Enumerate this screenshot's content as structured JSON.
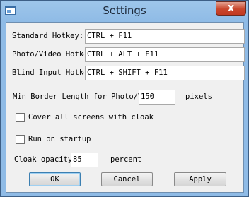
{
  "window": {
    "title": "Settings",
    "app_icon": "window-app-icon",
    "close_glyph": "X"
  },
  "hotkeys": {
    "standard_label": "Standard Hotkey:",
    "standard_value": "CTRL + F11",
    "photo_label": "Photo/Video Hotkey:",
    "photo_value": "CTRL + ALT + F11",
    "blind_label": "Blind Input Hotkey:",
    "blind_value": "CTRL + SHIFT + F11"
  },
  "border": {
    "label": "Min Border Length for Photo/Video:",
    "value": "150",
    "unit": "pixels"
  },
  "cover_all_screens": {
    "label": "Cover all screens with cloak",
    "checked": false
  },
  "run_on_startup": {
    "label": "Run on startup",
    "checked": false
  },
  "opacity": {
    "label": "Cloak opacity",
    "value": "85",
    "unit": "percent"
  },
  "buttons": {
    "ok": "OK",
    "cancel": "Cancel",
    "apply": "Apply"
  }
}
